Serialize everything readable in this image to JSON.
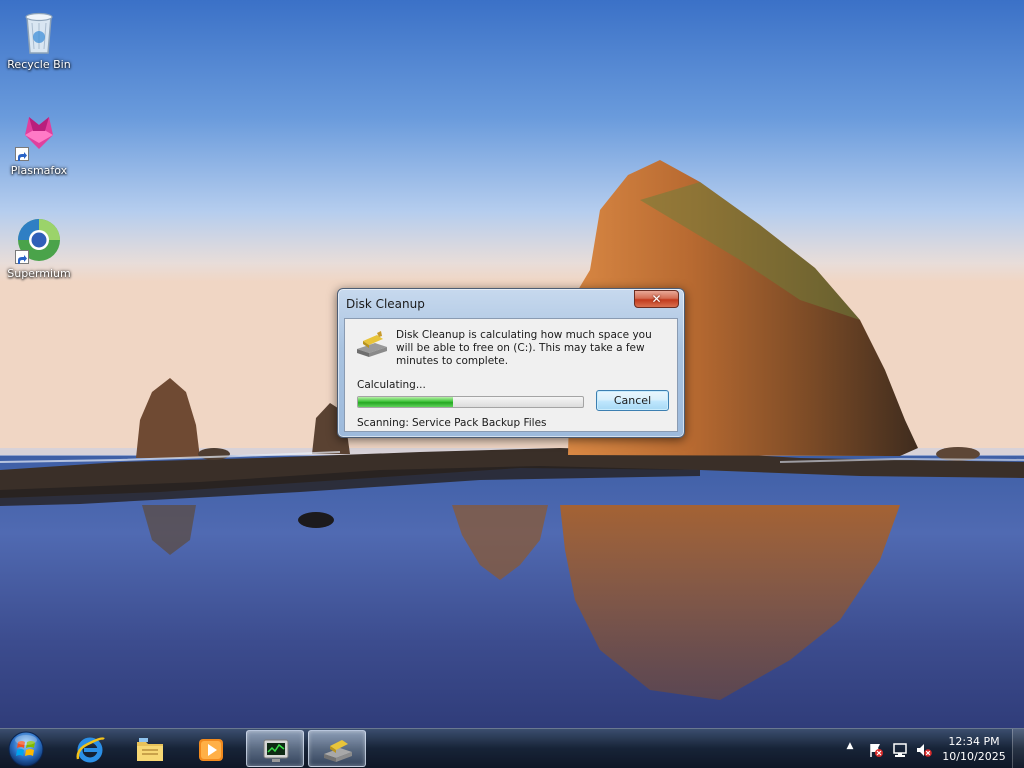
{
  "desktop": {
    "icons": [
      {
        "label": "Recycle Bin",
        "icon": "recycle-bin-icon"
      },
      {
        "label": "Plasmafox",
        "icon": "plasmafox-icon"
      },
      {
        "label": "Supermium",
        "icon": "supermium-icon"
      }
    ]
  },
  "dialog": {
    "title": "Disk Cleanup",
    "close_label": "✕",
    "message": "Disk Cleanup is calculating how much space you will be able to free on  (C:). This may take a few minutes to complete.",
    "status_label": "Calculating...",
    "progress": 0.42,
    "cancel_label": "Cancel",
    "scanning_label": "Scanning:",
    "scanning_value": "Service Pack Backup Files"
  },
  "taskbar": {
    "start": "start-orb-icon",
    "pinned": [
      {
        "icon": "internet-explorer-icon"
      },
      {
        "icon": "file-explorer-icon"
      },
      {
        "icon": "media-player-icon"
      },
      {
        "icon": "task-manager-icon",
        "active": true
      },
      {
        "icon": "disk-cleanup-icon",
        "active": true
      }
    ],
    "tray": {
      "show_hidden": "▲",
      "icons": [
        "action-center-flag-icon",
        "network-icon",
        "volume-muted-icon"
      ]
    },
    "clock": {
      "time": "12:34 PM",
      "date": "10/10/2025"
    }
  },
  "colors": {
    "progress": "#2fb52b",
    "taskbar": "#16223a",
    "dialog_frame": "#a9c3e0"
  }
}
